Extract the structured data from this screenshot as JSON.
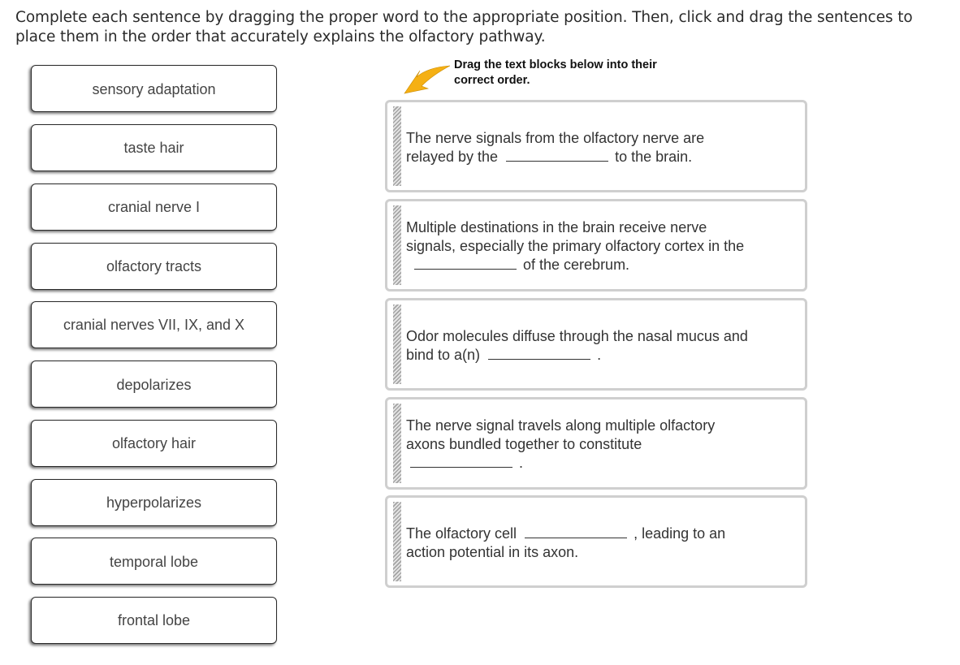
{
  "instructions": "Complete each sentence by dragging the proper word to the appropriate position. Then, click and drag the sentences to place them in the order that accurately explains the olfactory pathway.",
  "hint": {
    "icon": "arrow-pointer-icon",
    "text": "Drag the text blocks below into their correct order.",
    "arrow_color": "#f5b014"
  },
  "word_bank": [
    {
      "label": "sensory adaptation"
    },
    {
      "label": "taste hair"
    },
    {
      "label": "cranial nerve I"
    },
    {
      "label": "olfactory tracts"
    },
    {
      "label": "cranial nerves VII, IX, and X"
    },
    {
      "label": "depolarizes"
    },
    {
      "label": "olfactory hair"
    },
    {
      "label": "hyperpolarizes"
    },
    {
      "label": "temporal lobe"
    },
    {
      "label": "frontal lobe"
    }
  ],
  "sentences": [
    {
      "before": "The nerve signals from the olfactory nerve are relayed by the",
      "after": "to the brain."
    },
    {
      "before": "Multiple destinations in the brain receive nerve signals, especially the primary olfactory cortex in the",
      "after": "of the cerebrum."
    },
    {
      "before": "Odor molecules diffuse through the nasal mucus and bind to a(n)",
      "after": "."
    },
    {
      "before": "The nerve signal travels along multiple olfactory axons bundled together to constitute",
      "after": "."
    },
    {
      "before": "The olfactory cell",
      "after": ", leading to an action potential in its axon."
    }
  ]
}
